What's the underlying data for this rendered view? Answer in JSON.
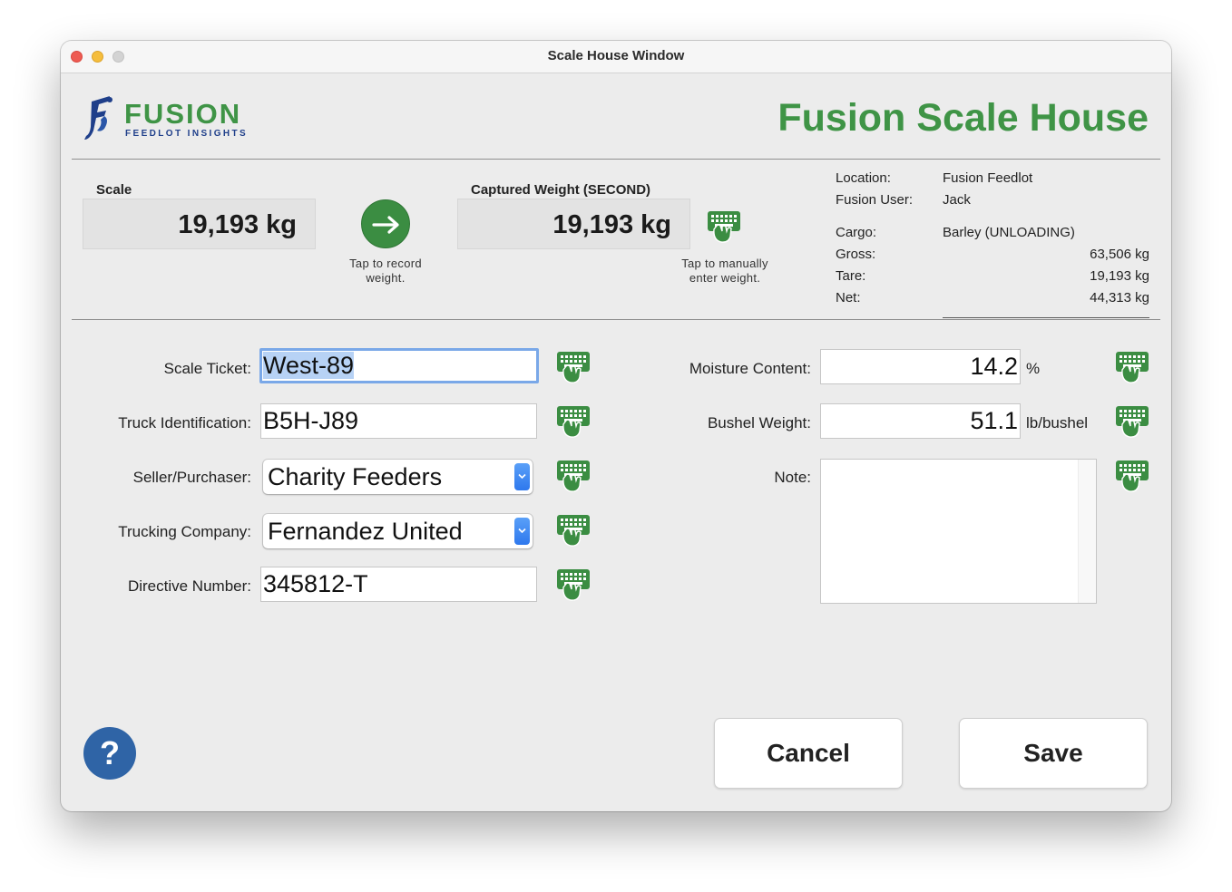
{
  "window": {
    "title": "Scale House Window"
  },
  "logo": {
    "word": "FUSION",
    "subtitle": "FEEDLOT INSIGHTS"
  },
  "header": {
    "title": "Fusion Scale House"
  },
  "scale": {
    "label": "Scale",
    "value": "19,193 kg",
    "record_hint_1": "Tap to record",
    "record_hint_2": "weight."
  },
  "captured": {
    "label": "Captured Weight (SECOND)",
    "value": "19,193 kg",
    "manual_hint_1": "Tap to manually",
    "manual_hint_2": "enter weight."
  },
  "info": {
    "location_label": "Location:",
    "location": "Fusion Feedlot",
    "user_label": "Fusion User:",
    "user": "Jack",
    "cargo_label": "Cargo:",
    "cargo": "Barley (UNLOADING)",
    "gross_label": "Gross:",
    "gross": "63,506 kg",
    "tare_label": "Tare:",
    "tare": "19,193 kg",
    "net_label": "Net:",
    "net": "44,313 kg"
  },
  "form": {
    "scale_ticket_label": "Scale Ticket:",
    "scale_ticket": "West-89",
    "truck_label": "Truck Identification:",
    "truck": "B5H-J89",
    "seller_label": "Seller/Purchaser:",
    "seller": "Charity Feeders",
    "trucking_label": "Trucking Company:",
    "trucking": "Fernandez United",
    "directive_label": "Directive Number:",
    "directive": "345812-T",
    "moisture_label": "Moisture Content:",
    "moisture": "14.2",
    "moisture_unit": "%",
    "bushel_label": "Bushel Weight:",
    "bushel": "51.1",
    "bushel_unit": "lb/bushel",
    "note_label": "Note:",
    "note": ""
  },
  "buttons": {
    "help": "?",
    "cancel": "Cancel",
    "save": "Save"
  },
  "icons": {
    "keyboard": "keyboard-hand-icon",
    "record": "arrow-right-icon",
    "help": "question-mark-icon",
    "popup": "chevron-down-icon"
  },
  "colors": {
    "brand_green": "#3f9446",
    "brand_blue": "#1f3f8a",
    "help_blue": "#2f64a6",
    "focus_ring": "#7aa8e8"
  }
}
